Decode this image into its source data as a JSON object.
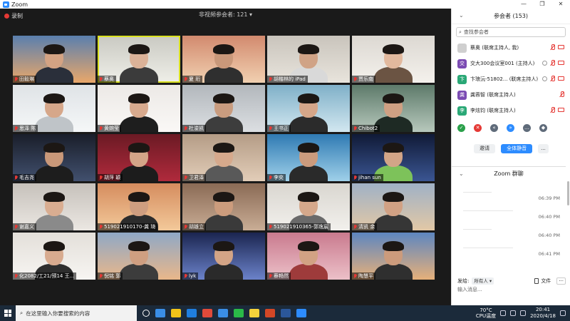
{
  "window": {
    "title": "Zoom",
    "controls": {
      "minimize": "—",
      "restore": "❐",
      "close": "✕"
    }
  },
  "recording": {
    "label": "录制"
  },
  "non_video_label": "非视频参会者: 121 ▾",
  "participants_tiles": [
    {
      "name": "田毅琳",
      "bg": "#5a7fae",
      "bg2": "#e9a76a",
      "skin": "#d4a383",
      "shirt": "#2a2f3a",
      "active": false
    },
    {
      "name": "蔡奥",
      "bg": "#c9c9c2",
      "bg2": "#efefe8",
      "skin": "#dbb298",
      "shirt": "#3b3b3b",
      "active": true
    },
    {
      "name": "夏 珩",
      "bg": "#d28a6e",
      "bg2": "#f1d0b0",
      "skin": "#c9987a",
      "shirt": "#2f2f2f",
      "active": false
    },
    {
      "name": "胡楷林的 iPad",
      "bg": "#c9c4bc",
      "bg2": "#e8e4dc",
      "skin": "#d0a386",
      "shirt": "#d9d9d9",
      "active": false
    },
    {
      "name": "贾乐南",
      "bg": "#dcd8d2",
      "bg2": "#f4f1ec",
      "skin": "#e2b99e",
      "shirt": "#6b5443",
      "active": false
    },
    {
      "name": "思泽 陈",
      "bg": "#dfe3e6",
      "bg2": "#f5f7f8",
      "skin": "#d6a78a",
      "shirt": "#bfc4c8",
      "active": false
    },
    {
      "name": "黄婉莹",
      "bg": "#ece9e6",
      "bg2": "#faf8f6",
      "skin": "#d8aa8e",
      "shirt": "#1e1e1e",
      "active": false
    },
    {
      "name": "杜浚凯",
      "bg": "#b2b7bc",
      "bg2": "#dcdfe2",
      "skin": "#c99c7f",
      "shirt": "#3d3d3d",
      "active": false
    },
    {
      "name": "王书正",
      "bg": "#7fb0c8",
      "bg2": "#d2e7f0",
      "skin": "#d5a689",
      "shirt": "#2b2b2b",
      "active": false
    },
    {
      "name": "Chibot2",
      "bg": "#5d7a6a",
      "bg2": "#b7c8bc",
      "skin": "#cfa083",
      "shirt": "#1e2a24",
      "active": false
    },
    {
      "name": "毛吉尧",
      "bg": "#1a1e2a",
      "bg2": "#41506e",
      "skin": "#c99879",
      "shirt": "#1d1d1d",
      "active": false
    },
    {
      "name": "胡萍 颖",
      "bg": "#6b1a24",
      "bg2": "#b02a3c",
      "skin": "#d3a588",
      "shirt": "#1c1c1c",
      "active": false
    },
    {
      "name": "卫君泽",
      "bg": "#b49c86",
      "bg2": "#e2cdb8",
      "skin": "#d6a98c",
      "shirt": "#595959",
      "active": false
    },
    {
      "name": "李奕",
      "bg": "#2f7ab3",
      "bg2": "#9fd0e9",
      "skin": "#cb9b7d",
      "shirt": "#2a2a2a",
      "active": false
    },
    {
      "name": "jihan sun",
      "bg": "#101a36",
      "bg2": "#3a5592",
      "skin": "#d2a587",
      "shirt": "#7dc25a",
      "active": false
    },
    {
      "name": "谢嘉义",
      "bg": "#c6c1bb",
      "bg2": "#ebe7e2",
      "skin": "#d9ad91",
      "shirt": "#8a8a8a",
      "active": false
    },
    {
      "name": "519021910170-龚 琦",
      "bg": "#d58c5e",
      "bg2": "#f3c99a",
      "skin": "#cf9e80",
      "shirt": "#2c2c2c",
      "active": false
    },
    {
      "name": "胡雄立",
      "bg": "#8a6a55",
      "bg2": "#c9ad95",
      "skin": "#cc9c7d",
      "shirt": "#3a3a3a",
      "active": false
    },
    {
      "name": "519021910365-郭逸宸",
      "bg": "#d9d6d0",
      "bg2": "#f2f0ec",
      "skin": "#d5a88b",
      "shirt": "#6a6a6a",
      "active": false
    },
    {
      "name": "清凯 余",
      "bg": "#9fb1c6",
      "bg2": "#e2c8a6",
      "skin": "#d1a184",
      "shirt": "#363636",
      "active": false
    },
    {
      "name": "化2082/工21/预14 王...",
      "bg": "#e3dfd9",
      "bg2": "#f7f5f2",
      "skin": "#d8ab8f",
      "shirt": "#2e2e2e",
      "active": false
    },
    {
      "name": "倪铭 郭",
      "bg": "#8fa8c6",
      "bg2": "#e9b78a",
      "skin": "#cf9f81",
      "shirt": "#3c3c3c",
      "active": false
    },
    {
      "name": "lyk",
      "bg": "#1b2550",
      "bg2": "#6b82c9",
      "skin": "#d3a486",
      "shirt": "#2a2a2a",
      "active": false
    },
    {
      "name": "蔡畅然",
      "bg": "#c97a8e",
      "bg2": "#ecc0c8",
      "skin": "#d2a284",
      "shirt": "#9e3b3b",
      "active": false
    },
    {
      "name": "陶慧平",
      "bg": "#5d86c0",
      "bg2": "#e6b07a",
      "skin": "#cc9b7c",
      "shirt": "#2f2f2f",
      "active": false
    }
  ],
  "sidebar": {
    "participants_title": "参会者 (153)",
    "search_placeholder": "查找参会者",
    "participants": [
      {
        "initial": "",
        "name": "蔡奥 (联席主持人, 我)",
        "color": "#cfcfcf",
        "has_video_icon": true,
        "has_circle": false
      },
      {
        "initial": "交",
        "name": "交大300会议室001 (主持人)",
        "color": "#7b4bb3",
        "has_video_icon": true,
        "has_circle": true
      },
      {
        "initial": "卞",
        "name": "卞琅沅-51802... (联席主持人)",
        "color": "#2aa876",
        "has_video_icon": true,
        "has_circle": true
      },
      {
        "initial": "龚",
        "name": "龚蓉智 (联席主持人)",
        "color": "#7b4bb3",
        "has_video_icon": false,
        "has_circle": false
      },
      {
        "initial": "李",
        "name": "李炫钧 (联席主持人)",
        "color": "#2aa876",
        "has_video_icon": true,
        "has_circle": false
      }
    ],
    "reactions": [
      {
        "icon": "check-icon",
        "glyph": "✓",
        "color": "#2aa04a"
      },
      {
        "icon": "cross-icon",
        "glyph": "✕",
        "color": "#e53935"
      },
      {
        "icon": "slower-icon",
        "glyph": "«",
        "color": "#5f6b7a"
      },
      {
        "icon": "faster-icon",
        "glyph": "»",
        "color": "#2d8cff"
      },
      {
        "icon": "more-icon",
        "glyph": "…",
        "color": "#5f6b7a"
      },
      {
        "icon": "clear-icon",
        "glyph": "◆",
        "color": "#5f6b7a"
      }
    ],
    "buttons": {
      "invite": "邀请",
      "mute_all": "全体静音",
      "more": "..."
    },
    "chat_title": "Zoom 群聊",
    "chat_times": [
      "06:39 PM",
      "06:40 PM",
      "06:40 PM",
      "06:41 PM"
    ],
    "send_to_label": "发给:",
    "send_to_value": "所有人 ▾",
    "file_label": "文件",
    "more_label": "···",
    "chat_placeholder": "输入消息..."
  },
  "taskbar": {
    "search_placeholder": "在这里输入你要搜索的内容",
    "apps": [
      {
        "icon": "task-view-icon",
        "color": "#ffffff"
      },
      {
        "icon": "mail-icon",
        "color": "#3a8ee6"
      },
      {
        "icon": "explorer-icon",
        "color": "#f0c419"
      },
      {
        "icon": "edge-icon",
        "color": "#1f7fe0"
      },
      {
        "icon": "chrome-icon",
        "color": "#e04a3a"
      },
      {
        "icon": "store-icon",
        "color": "#3a8ee6"
      },
      {
        "icon": "wechat-icon",
        "color": "#2aba48"
      },
      {
        "icon": "sticky-notes-icon",
        "color": "#f5d33b"
      },
      {
        "icon": "powerpoint-icon",
        "color": "#d24726"
      },
      {
        "icon": "word-icon",
        "color": "#2b579a"
      },
      {
        "icon": "zoom-taskbar-icon",
        "color": "#2d8cff"
      }
    ],
    "weather_temp": "70°C",
    "weather_label": "CPU温度",
    "time": "20:41",
    "date": "2020/4/18"
  }
}
